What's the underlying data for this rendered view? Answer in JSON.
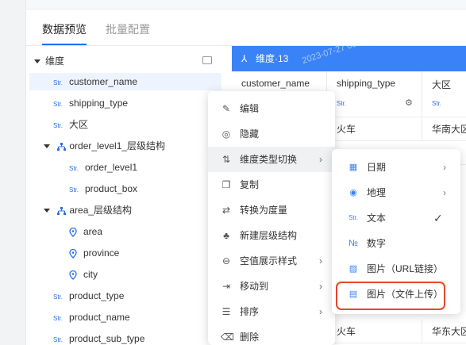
{
  "tabs": [
    {
      "label": "数据预览",
      "active": true
    },
    {
      "label": "批量配置",
      "active": false
    }
  ],
  "tree": {
    "root_label": "维度",
    "items": [
      {
        "tag": "Str.",
        "label": "customer_name",
        "selected": true
      },
      {
        "tag": "Str.",
        "label": "shipping_type"
      },
      {
        "tag": "Str.",
        "label": "大区"
      },
      {
        "tag": "hierarchy",
        "label": "order_level1_层级结构"
      },
      {
        "tag": "Str.",
        "label": "order_level1"
      },
      {
        "tag": "Str.",
        "label": "product_box"
      },
      {
        "tag": "hierarchy",
        "label": "area_层级结构"
      },
      {
        "tag": "geo",
        "label": "area"
      },
      {
        "tag": "geo",
        "label": "province"
      },
      {
        "tag": "geo",
        "label": "city"
      },
      {
        "tag": "Str.",
        "label": "product_type"
      },
      {
        "tag": "Str.",
        "label": "product_name"
      },
      {
        "tag": "Str.",
        "label": "product_sub_type"
      }
    ]
  },
  "grid": {
    "header_label": "维度·13",
    "watermark": "2023-07-27 09:13:50",
    "columns": [
      {
        "label": "customer_name",
        "tag": ""
      },
      {
        "label": "shipping_type",
        "tag": "Str."
      },
      {
        "label": "大区",
        "tag": "Str."
      }
    ],
    "rows": [
      [
        "",
        "火车",
        "华南大区"
      ],
      [
        "",
        "",
        ""
      ],
      [
        "",
        "",
        ""
      ],
      [
        "",
        "",
        ""
      ],
      [
        "",
        "",
        ""
      ],
      [
        "",
        "",
        ""
      ],
      [
        "",
        "",
        ""
      ],
      [
        "",
        "",
        ""
      ],
      [
        "",
        "火车",
        "华东大区"
      ]
    ]
  },
  "context_menu": {
    "items": [
      {
        "icon": "edit-icon",
        "glyph": "✎",
        "label": "编辑",
        "submenu": false
      },
      {
        "icon": "hide-icon",
        "glyph": "◎",
        "label": "隐藏",
        "submenu": false
      },
      {
        "icon": "switch-type-icon",
        "glyph": "⇅",
        "label": "维度类型切换",
        "submenu": true,
        "hover": true
      },
      {
        "icon": "copy-icon",
        "glyph": "❐",
        "label": "复制",
        "submenu": false
      },
      {
        "icon": "convert-icon",
        "glyph": "⇄",
        "label": "转换为度量",
        "submenu": false
      },
      {
        "icon": "hierarchy-icon",
        "glyph": "♣",
        "label": "新建层级结构",
        "submenu": false
      },
      {
        "icon": "null-display-icon",
        "glyph": "⊖",
        "label": "空值展示样式",
        "submenu": true
      },
      {
        "icon": "move-icon",
        "glyph": "⇥",
        "label": "移动到",
        "submenu": true
      },
      {
        "icon": "sort-icon",
        "glyph": "☰",
        "label": "排序",
        "submenu": true
      },
      {
        "icon": "delete-icon",
        "glyph": "🗑",
        "label": "删除",
        "submenu": false
      }
    ]
  },
  "type_submenu": {
    "items": [
      {
        "icon": "calendar-icon",
        "glyph": "▦",
        "label": "日期",
        "submenu": true
      },
      {
        "icon": "location-icon",
        "glyph": "◉",
        "label": "地理",
        "submenu": true
      },
      {
        "icon": "text-icon",
        "glyph": "Str.",
        "label": "文本",
        "checked": true
      },
      {
        "icon": "number-icon",
        "glyph": "№",
        "label": "数字"
      },
      {
        "icon": "image-url-icon",
        "glyph": "▨",
        "label": "图片（URL链接）"
      },
      {
        "icon": "image-upload-icon",
        "glyph": "▤",
        "label": "图片（文件上传）",
        "highlighted": true
      }
    ]
  },
  "colors": {
    "accent": "#3a82f7",
    "highlight": "#e8452c"
  }
}
